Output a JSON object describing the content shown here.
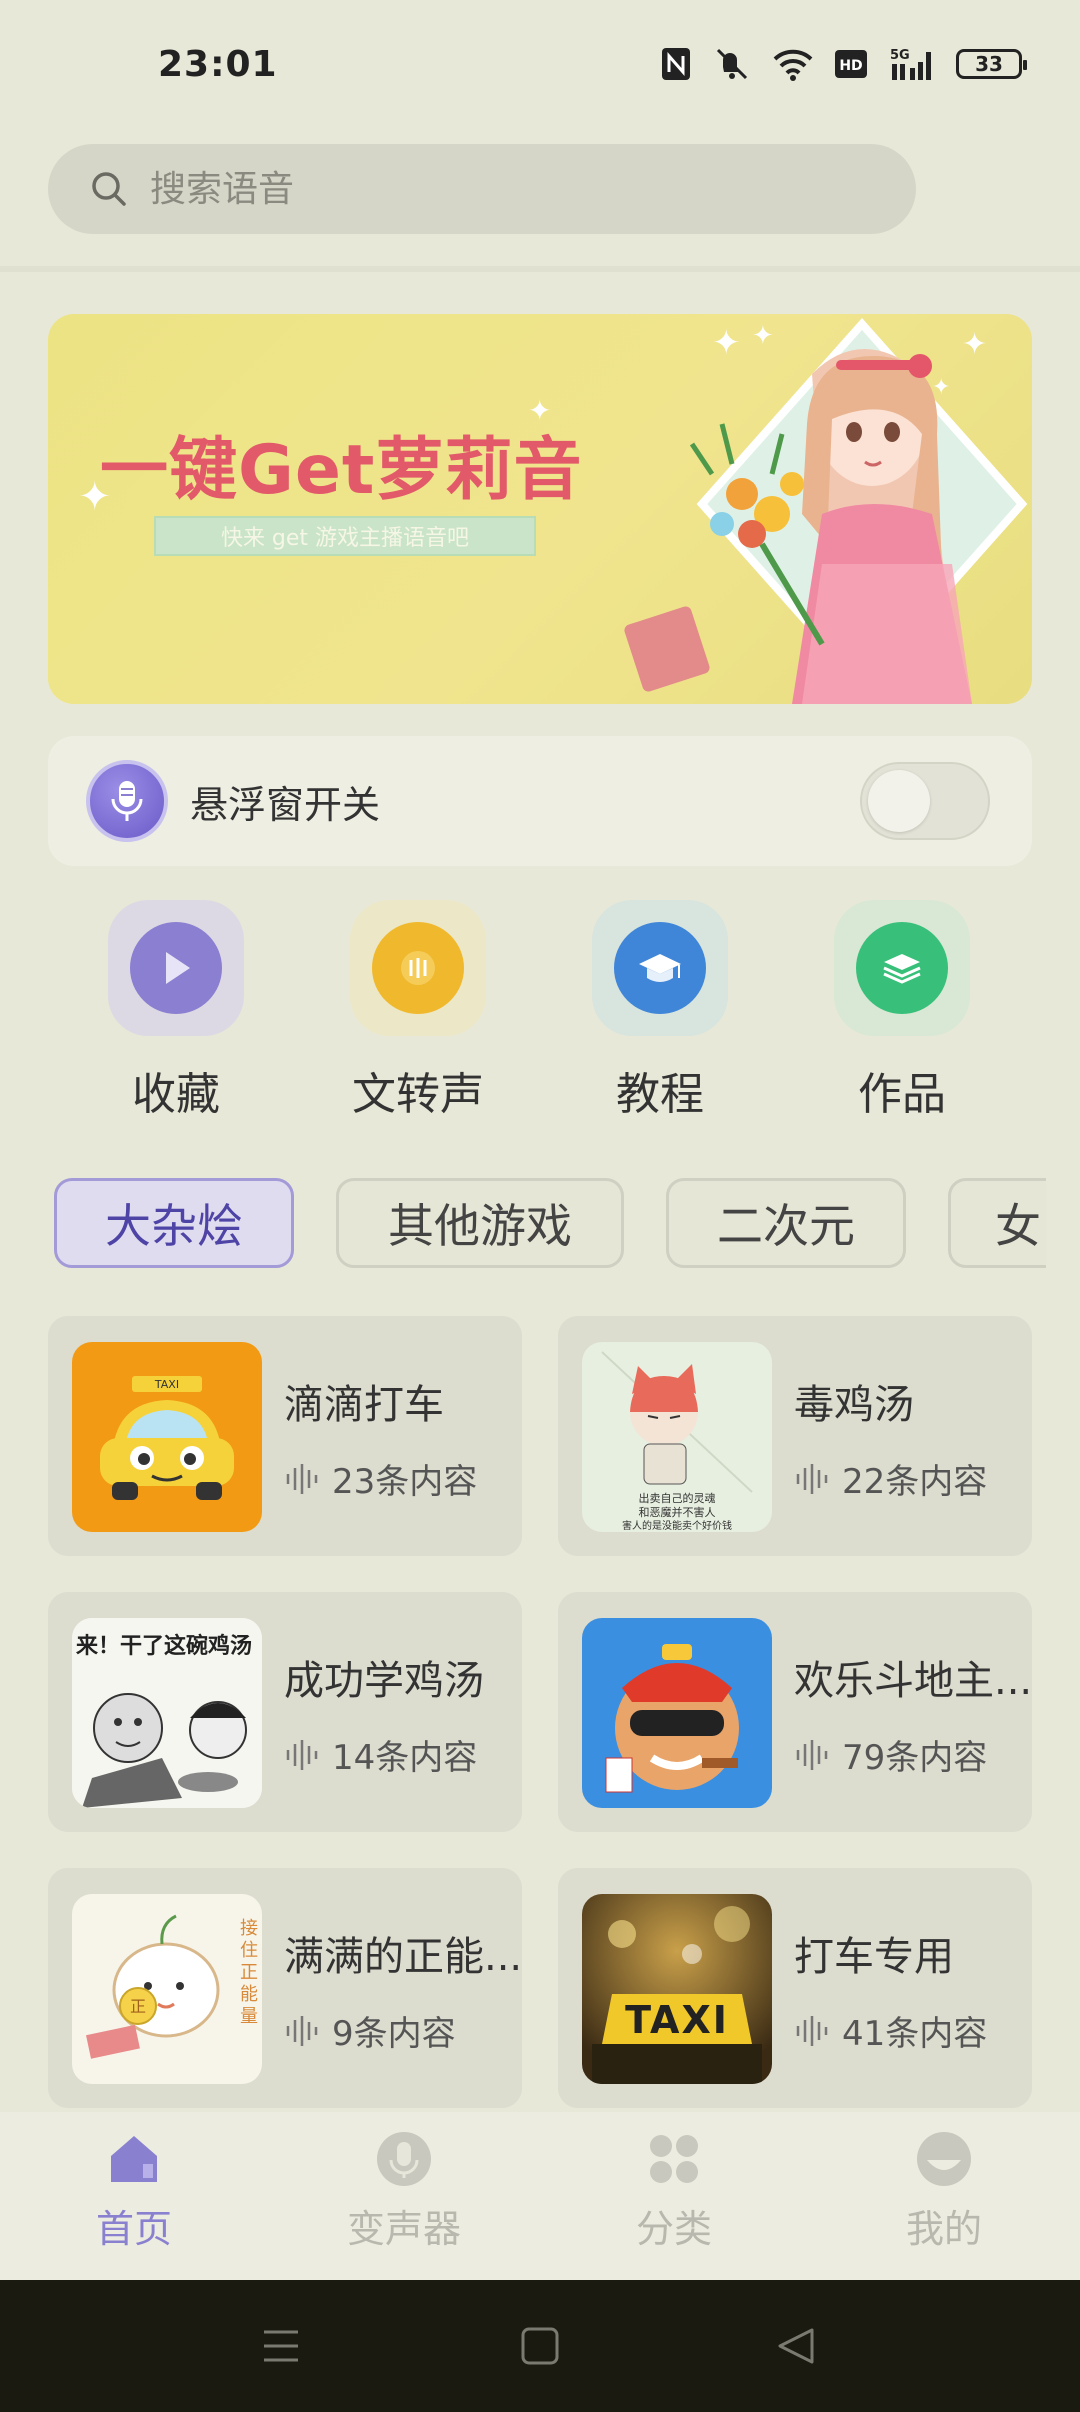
{
  "status_bar": {
    "time": "23:01",
    "battery": "33",
    "icons": [
      "nfc-icon",
      "mute-icon",
      "wifi-icon",
      "hd-icon",
      "5g-signal-icon",
      "battery-icon"
    ]
  },
  "search": {
    "placeholder": "搜索语音"
  },
  "banner": {
    "title": "一键Get萝莉音",
    "subtitle": "快来 get 游戏主播语音吧"
  },
  "floating_window": {
    "label": "悬浮窗开关",
    "enabled": false
  },
  "quick_actions": [
    {
      "label": "收藏",
      "icon": "play-icon",
      "color": "#8a7fd0"
    },
    {
      "label": "文转声",
      "icon": "audio-icon",
      "color": "#f0b82c"
    },
    {
      "label": "教程",
      "icon": "graduation-cap-icon",
      "color": "#3f86d8"
    },
    {
      "label": "作品",
      "icon": "layers-icon",
      "color": "#38c07a"
    }
  ],
  "category_tabs": [
    {
      "label": "大杂烩",
      "active": true
    },
    {
      "label": "其他游戏",
      "active": false
    },
    {
      "label": "二次元",
      "active": false
    },
    {
      "label": "女",
      "active": false
    }
  ],
  "packs": [
    {
      "title": "滴滴打车",
      "count": "23条内容",
      "thumb": "taxi-car-image"
    },
    {
      "title": "毒鸡汤",
      "count": "22条内容",
      "thumb": "cartoon-cat-image"
    },
    {
      "title": "成功学鸡汤",
      "count": "14条内容",
      "thumb": "meme-image",
      "thumb_text": "来！干了这碗鸡汤"
    },
    {
      "title": "欢乐斗地主...",
      "count": "79条内容",
      "thumb": "landlord-cartoon-image"
    },
    {
      "title": "满满的正能...",
      "count": "9条内容",
      "thumb": "positive-energy-image"
    },
    {
      "title": "打车专用",
      "count": "41条内容",
      "thumb": "taxi-sign-image",
      "thumb_text": "TAXI"
    }
  ],
  "bottom_nav": [
    {
      "label": "首页",
      "icon": "home-icon",
      "active": true
    },
    {
      "label": "变声器",
      "icon": "microphone-icon",
      "active": false
    },
    {
      "label": "分类",
      "icon": "grid-icon",
      "active": false
    },
    {
      "label": "我的",
      "icon": "profile-icon",
      "active": false
    }
  ],
  "colors": {
    "accent": "#8a80d0",
    "background": "#e8e8d8",
    "banner_title": "#e25a6a"
  }
}
